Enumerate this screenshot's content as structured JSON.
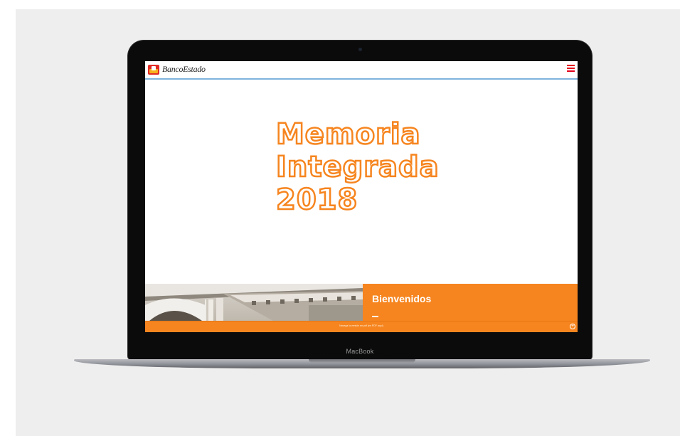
{
  "device": {
    "brand_label": "MacBook"
  },
  "site": {
    "logo_text": "BancoEstado",
    "logo_icon": "bancoestado-logo-icon",
    "menu_icon": "hamburger-menu-icon",
    "accent_color": "#f6851f",
    "menu_color": "#e3001b",
    "hero": {
      "title_lines": [
        "Memoria",
        "Integrada",
        "2018"
      ]
    },
    "welcome": {
      "title": "Bienvenidos"
    },
    "footer": {
      "text": "Navega la versión en pdf (en PDF aquí)",
      "icon": "plus-circle-icon"
    }
  }
}
